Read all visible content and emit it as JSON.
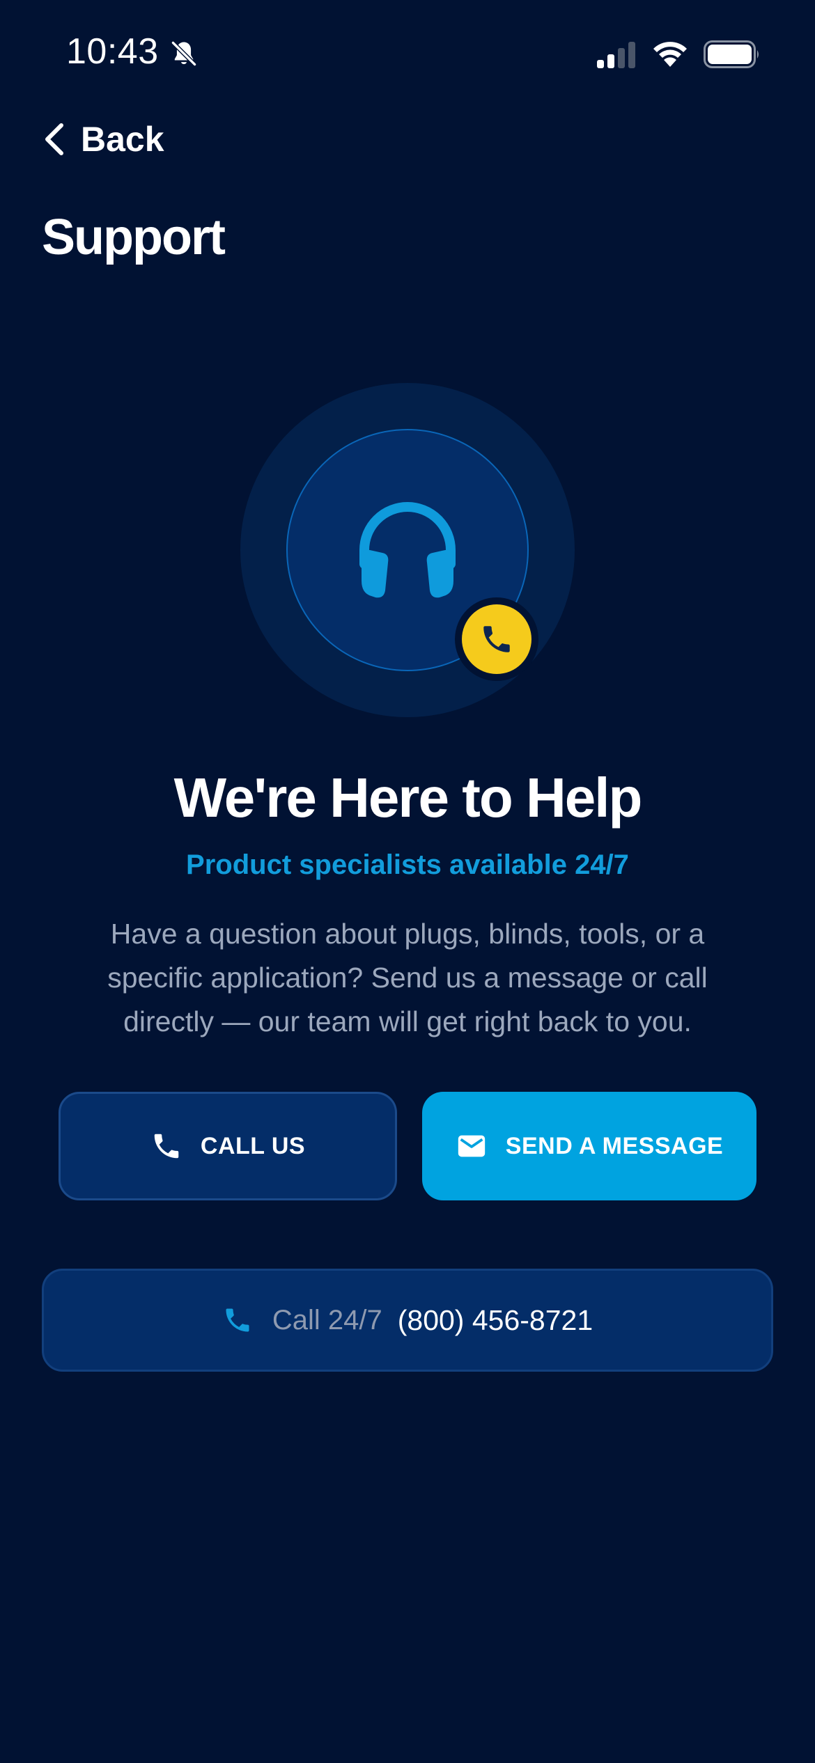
{
  "status_bar": {
    "time": "10:43",
    "icons": [
      "bell-slash-icon",
      "signal-icon",
      "wifi-icon",
      "battery-icon"
    ]
  },
  "nav": {
    "back_label": "Back",
    "back_icon": "chevron-left-icon"
  },
  "page": {
    "title": "Support"
  },
  "hero": {
    "main_icon": "headphones-icon",
    "badge_icon": "phone-icon"
  },
  "content": {
    "headline": "We're Here to Help",
    "subheadline": "Product specialists available 24/7",
    "description": "Have a question about plugs, blinds, tools, or a specific application? Send us a message or call directly — our team will get right back to you."
  },
  "actions": {
    "call_label": "CALL US",
    "call_icon": "phone-icon",
    "message_label": "SEND A MESSAGE",
    "message_icon": "envelope-icon"
  },
  "call_bar": {
    "prefix": "Call 24/7",
    "number": "(800) 456-8721",
    "icon": "phone-icon"
  },
  "colors": {
    "background": "#011233",
    "accent_blue": "#00a3e0",
    "subheadline_blue": "#129ddc",
    "badge_yellow": "#f5cb1c",
    "card_navy": "#042d68",
    "muted_text": "#9ca8bd"
  }
}
